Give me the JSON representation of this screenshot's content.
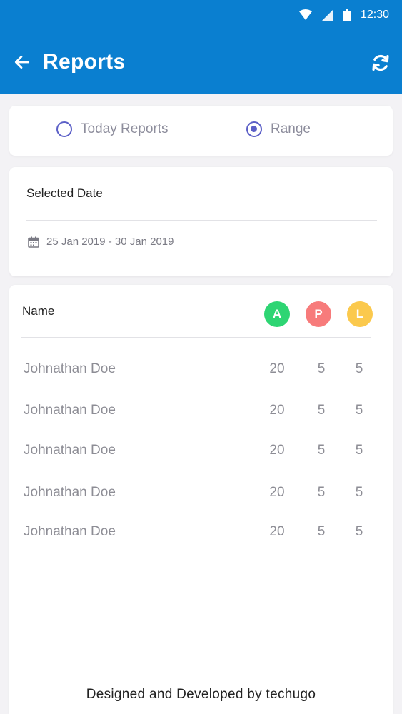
{
  "status_bar": {
    "time": "12:30"
  },
  "app_bar": {
    "title": "Reports"
  },
  "report_type": {
    "options": [
      {
        "label": "Today Reports",
        "selected": false
      },
      {
        "label": "Range",
        "selected": true
      }
    ]
  },
  "selected_date": {
    "label": "Selected Date",
    "range": "25 Jan 2019 - 30 Jan 2019"
  },
  "table": {
    "name_header": "Name",
    "columns": [
      {
        "label": "A",
        "color": "#2ed573"
      },
      {
        "label": "P",
        "color": "#f77b7b"
      },
      {
        "label": "L",
        "color": "#fbc94d"
      }
    ],
    "rows": [
      {
        "name": "Johnathan Doe",
        "a": "20",
        "p": "5",
        "l": "5"
      },
      {
        "name": "Johnathan Doe",
        "a": "20",
        "p": "5",
        "l": "5"
      },
      {
        "name": "Johnathan Doe",
        "a": "20",
        "p": "5",
        "l": "5"
      },
      {
        "name": "Johnathan Doe",
        "a": "20",
        "p": "5",
        "l": "5"
      },
      {
        "name": "Johnathan Doe",
        "a": "20",
        "p": "5",
        "l": "5"
      }
    ]
  },
  "footer": {
    "text": "Designed and Developed by",
    "brand": "techugo"
  },
  "colors": {
    "primary": "#0a7fd0",
    "radio": "#5b5fc7"
  }
}
